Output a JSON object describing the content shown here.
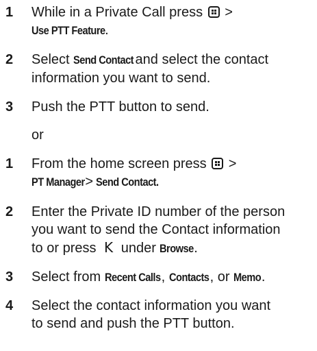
{
  "section_a": {
    "step1": {
      "num": "1",
      "text_a": "While in a Private Call press",
      "text_b": ">",
      "menu_a": "Use PTT Feature",
      "text_c": "."
    },
    "step2": {
      "num": "2",
      "text_a": "Select",
      "menu_a": "Send Contact",
      "text_b": "and select the contact",
      "line2": "information you want to send."
    },
    "step3": {
      "num": "3",
      "text_a": "Push the PTT button to send."
    }
  },
  "or_text": "or",
  "section_b": {
    "step1": {
      "num": "1",
      "text_a": "From the home screen press",
      "text_b": ">",
      "menu_a": "PT Manager",
      "sep": ">",
      "menu_b": "Send Contact."
    },
    "step2": {
      "num": "2",
      "line1": "Enter the Private ID number of the person",
      "line2": "you want to send the Contact information",
      "text_a": "to or press",
      "softkey": "K",
      "text_b": "under",
      "menu_a": "Browse",
      "text_c": "."
    },
    "step3": {
      "num": "3",
      "text_a": "Select from",
      "menu_a": "Recent Calls",
      "sep1": ",",
      "menu_b": "Contacts",
      "sep2": ", or",
      "menu_c": "Memo",
      "text_b": "."
    },
    "step4": {
      "num": "4",
      "line1": "Select the contact information you want",
      "line2": "to send and push the PTT button."
    }
  }
}
